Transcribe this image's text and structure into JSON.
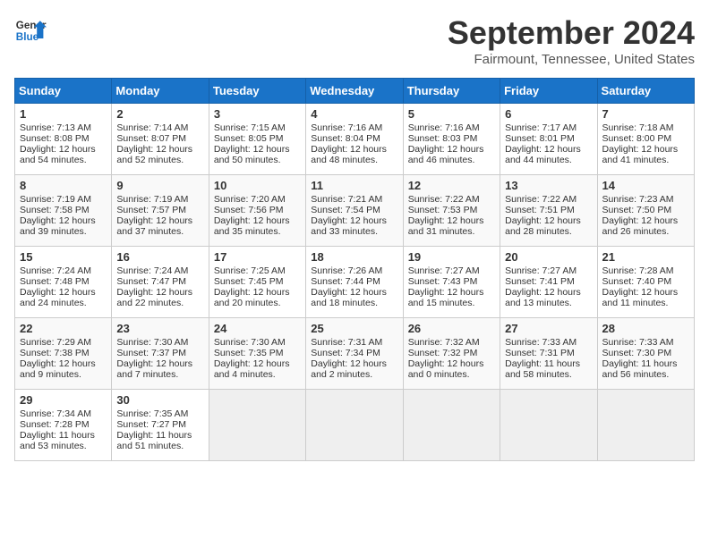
{
  "header": {
    "logo_line1": "General",
    "logo_line2": "Blue",
    "month": "September 2024",
    "location": "Fairmount, Tennessee, United States"
  },
  "weekdays": [
    "Sunday",
    "Monday",
    "Tuesday",
    "Wednesday",
    "Thursday",
    "Friday",
    "Saturday"
  ],
  "weeks": [
    [
      {
        "day": "1",
        "lines": [
          "Sunrise: 7:13 AM",
          "Sunset: 8:08 PM",
          "Daylight: 12 hours",
          "and 54 minutes."
        ]
      },
      {
        "day": "2",
        "lines": [
          "Sunrise: 7:14 AM",
          "Sunset: 8:07 PM",
          "Daylight: 12 hours",
          "and 52 minutes."
        ]
      },
      {
        "day": "3",
        "lines": [
          "Sunrise: 7:15 AM",
          "Sunset: 8:05 PM",
          "Daylight: 12 hours",
          "and 50 minutes."
        ]
      },
      {
        "day": "4",
        "lines": [
          "Sunrise: 7:16 AM",
          "Sunset: 8:04 PM",
          "Daylight: 12 hours",
          "and 48 minutes."
        ]
      },
      {
        "day": "5",
        "lines": [
          "Sunrise: 7:16 AM",
          "Sunset: 8:03 PM",
          "Daylight: 12 hours",
          "and 46 minutes."
        ]
      },
      {
        "day": "6",
        "lines": [
          "Sunrise: 7:17 AM",
          "Sunset: 8:01 PM",
          "Daylight: 12 hours",
          "and 44 minutes."
        ]
      },
      {
        "day": "7",
        "lines": [
          "Sunrise: 7:18 AM",
          "Sunset: 8:00 PM",
          "Daylight: 12 hours",
          "and 41 minutes."
        ]
      }
    ],
    [
      {
        "day": "8",
        "lines": [
          "Sunrise: 7:19 AM",
          "Sunset: 7:58 PM",
          "Daylight: 12 hours",
          "and 39 minutes."
        ]
      },
      {
        "day": "9",
        "lines": [
          "Sunrise: 7:19 AM",
          "Sunset: 7:57 PM",
          "Daylight: 12 hours",
          "and 37 minutes."
        ]
      },
      {
        "day": "10",
        "lines": [
          "Sunrise: 7:20 AM",
          "Sunset: 7:56 PM",
          "Daylight: 12 hours",
          "and 35 minutes."
        ]
      },
      {
        "day": "11",
        "lines": [
          "Sunrise: 7:21 AM",
          "Sunset: 7:54 PM",
          "Daylight: 12 hours",
          "and 33 minutes."
        ]
      },
      {
        "day": "12",
        "lines": [
          "Sunrise: 7:22 AM",
          "Sunset: 7:53 PM",
          "Daylight: 12 hours",
          "and 31 minutes."
        ]
      },
      {
        "day": "13",
        "lines": [
          "Sunrise: 7:22 AM",
          "Sunset: 7:51 PM",
          "Daylight: 12 hours",
          "and 28 minutes."
        ]
      },
      {
        "day": "14",
        "lines": [
          "Sunrise: 7:23 AM",
          "Sunset: 7:50 PM",
          "Daylight: 12 hours",
          "and 26 minutes."
        ]
      }
    ],
    [
      {
        "day": "15",
        "lines": [
          "Sunrise: 7:24 AM",
          "Sunset: 7:48 PM",
          "Daylight: 12 hours",
          "and 24 minutes."
        ]
      },
      {
        "day": "16",
        "lines": [
          "Sunrise: 7:24 AM",
          "Sunset: 7:47 PM",
          "Daylight: 12 hours",
          "and 22 minutes."
        ]
      },
      {
        "day": "17",
        "lines": [
          "Sunrise: 7:25 AM",
          "Sunset: 7:45 PM",
          "Daylight: 12 hours",
          "and 20 minutes."
        ]
      },
      {
        "day": "18",
        "lines": [
          "Sunrise: 7:26 AM",
          "Sunset: 7:44 PM",
          "Daylight: 12 hours",
          "and 18 minutes."
        ]
      },
      {
        "day": "19",
        "lines": [
          "Sunrise: 7:27 AM",
          "Sunset: 7:43 PM",
          "Daylight: 12 hours",
          "and 15 minutes."
        ]
      },
      {
        "day": "20",
        "lines": [
          "Sunrise: 7:27 AM",
          "Sunset: 7:41 PM",
          "Daylight: 12 hours",
          "and 13 minutes."
        ]
      },
      {
        "day": "21",
        "lines": [
          "Sunrise: 7:28 AM",
          "Sunset: 7:40 PM",
          "Daylight: 12 hours",
          "and 11 minutes."
        ]
      }
    ],
    [
      {
        "day": "22",
        "lines": [
          "Sunrise: 7:29 AM",
          "Sunset: 7:38 PM",
          "Daylight: 12 hours",
          "and 9 minutes."
        ]
      },
      {
        "day": "23",
        "lines": [
          "Sunrise: 7:30 AM",
          "Sunset: 7:37 PM",
          "Daylight: 12 hours",
          "and 7 minutes."
        ]
      },
      {
        "day": "24",
        "lines": [
          "Sunrise: 7:30 AM",
          "Sunset: 7:35 PM",
          "Daylight: 12 hours",
          "and 4 minutes."
        ]
      },
      {
        "day": "25",
        "lines": [
          "Sunrise: 7:31 AM",
          "Sunset: 7:34 PM",
          "Daylight: 12 hours",
          "and 2 minutes."
        ]
      },
      {
        "day": "26",
        "lines": [
          "Sunrise: 7:32 AM",
          "Sunset: 7:32 PM",
          "Daylight: 12 hours",
          "and 0 minutes."
        ]
      },
      {
        "day": "27",
        "lines": [
          "Sunrise: 7:33 AM",
          "Sunset: 7:31 PM",
          "Daylight: 11 hours",
          "and 58 minutes."
        ]
      },
      {
        "day": "28",
        "lines": [
          "Sunrise: 7:33 AM",
          "Sunset: 7:30 PM",
          "Daylight: 11 hours",
          "and 56 minutes."
        ]
      }
    ],
    [
      {
        "day": "29",
        "lines": [
          "Sunrise: 7:34 AM",
          "Sunset: 7:28 PM",
          "Daylight: 11 hours",
          "and 53 minutes."
        ]
      },
      {
        "day": "30",
        "lines": [
          "Sunrise: 7:35 AM",
          "Sunset: 7:27 PM",
          "Daylight: 11 hours",
          "and 51 minutes."
        ]
      },
      {
        "day": "",
        "lines": [],
        "empty": true
      },
      {
        "day": "",
        "lines": [],
        "empty": true
      },
      {
        "day": "",
        "lines": [],
        "empty": true
      },
      {
        "day": "",
        "lines": [],
        "empty": true
      },
      {
        "day": "",
        "lines": [],
        "empty": true
      }
    ]
  ]
}
